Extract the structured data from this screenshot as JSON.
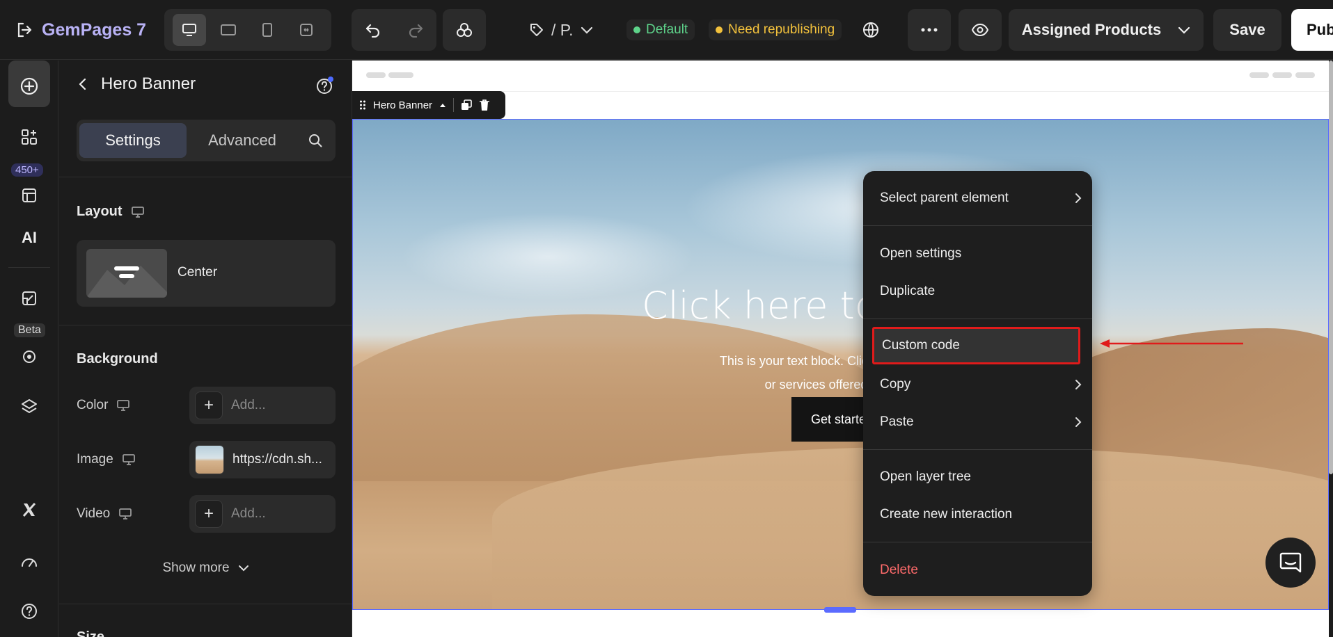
{
  "app": {
    "brand_name": "GemPages 7",
    "page_selector": "/ P.",
    "status_default": "Default",
    "status_republish": "Need republishing",
    "assigned_products": "Assigned Products",
    "save_label": "Save",
    "publish_label": "Publish"
  },
  "rail": {
    "templates_badge": "450+",
    "beta_badge": "Beta",
    "ai_label": "AI"
  },
  "panel": {
    "title": "Hero Banner",
    "tabs": [
      "Settings",
      "Advanced"
    ],
    "layout": {
      "title": "Layout",
      "value": "Center"
    },
    "background": {
      "title": "Background",
      "color_label": "Color",
      "color_placeholder": "Add...",
      "image_label": "Image",
      "image_value": "https://cdn.sh...",
      "video_label": "Video",
      "video_placeholder": "Add...",
      "show_more": "Show more"
    },
    "next_section": "Size"
  },
  "canvas": {
    "selection_tag": "Hero Banner",
    "hero_heading": "Click here to e",
    "hero_text_line1": "This is your text block. Click to edit and make it",
    "hero_text_line2": "or services offered. Get creativ",
    "hero_button": "Get starte"
  },
  "context_menu": {
    "items": [
      "Select parent element",
      "Open settings",
      "Duplicate",
      "Custom code",
      "Copy",
      "Paste",
      "Open layer tree",
      "Create new interaction",
      "Delete"
    ],
    "highlighted_color": "#e01b1b"
  },
  "colors": {
    "brand": "#b9b2f5",
    "default_badge": "#5ed38a",
    "republish_badge": "#f2c13c",
    "selection_outline": "#5b6bff",
    "danger": "#ff6b6b"
  }
}
